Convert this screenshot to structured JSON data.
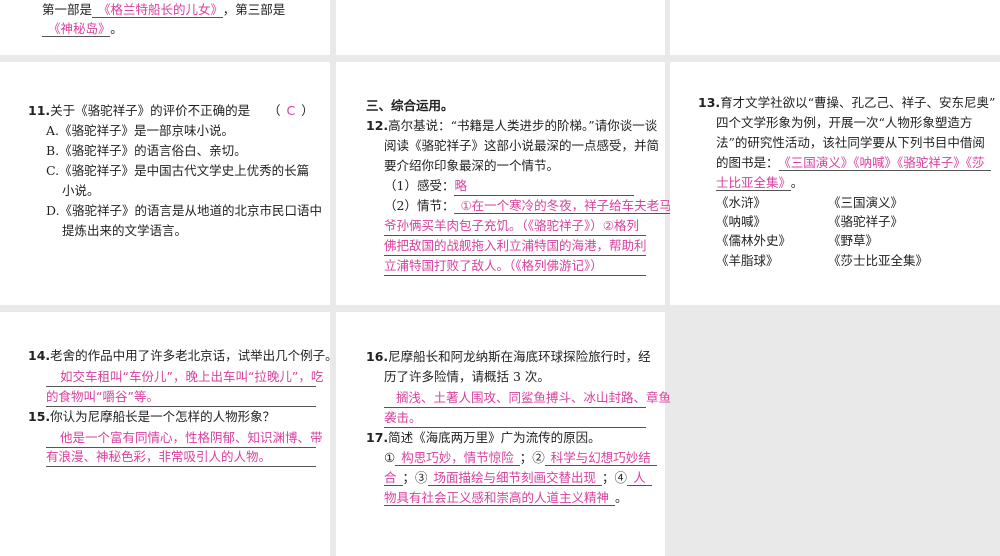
{
  "top_left": {
    "prefix": "第一部是",
    "answer1": "《格兰特船长的儿女》",
    "mid": "，第三部是",
    "answer2": "《神秘岛》",
    "end": "。"
  },
  "q11": {
    "num": "11.",
    "stem": "关于《骆驼祥子》的评价不正确的是",
    "paren_open": "（",
    "answer": "C",
    "paren_close": "）",
    "option_lines": [
      "A.《骆驼祥子》是一部京味小说。",
      "B.《骆驼祥子》的语言俗白、亲切。",
      "C.《骆驼祥子》是中国古代文学史上优秀的长篇",
      "小说。",
      "D.《骆驼祥子》的语言是从地道的北京市民口语中",
      "提炼出来的文学语言。"
    ]
  },
  "section3": "三、综合运用。",
  "q12": {
    "num": "12.",
    "stem_lines": [
      "高尔基说：“书籍是人类进步的阶梯。”请你谈一谈",
      "阅读《骆驼祥子》这部小说最深的一点感受，并简",
      "要介绍你印象最深的一个情节。"
    ],
    "part1_label": "（1）感受：",
    "part1_answer": "略",
    "part2_label": "（2）情节：",
    "part2_answer_lines": [
      "①在一个寒冷的冬夜，祥子给车夫老马",
      "爷孙俩买羊肉包子充饥。（《骆驼祥子》）②格列",
      "佛把敌国的战舰拖入利立浦特国的海港，帮助利",
      "立浦特国打败了敌人。（《格列佛游记》）"
    ]
  },
  "q13": {
    "num": "13.",
    "stem_lines": [
      "育才文学社欲以“曹操、孔乙己、祥子、安东尼奥”",
      "四个文学形象为例，开展一次“人物形象塑造方",
      "法”的研究性活动，该社同学要从下列书目中借阅"
    ],
    "answer_prefix": "的图书是：",
    "answer_lines": [
      "《三国演义》《呐喊》《骆驼祥子》《莎",
      "士比亚全集》"
    ],
    "end": "。",
    "books_left": [
      "《水浒》",
      "《呐喊》",
      "《儒林外史》",
      "《羊脂球》"
    ],
    "books_right": [
      "《三国演义》",
      "《骆驼祥子》",
      "《野草》",
      "《莎士比亚全集》"
    ]
  },
  "q14": {
    "num": "14.",
    "stem": "老舍的作品中用了许多老北京话，试举出几个例子。",
    "answer_lines": [
      "如交车租叫“车份儿”，晚上出车叫“拉晚儿”，吃",
      "的食物叫“嚼谷”等。"
    ]
  },
  "q15": {
    "num": "15.",
    "stem": "你认为尼摩船长是一个怎样的人物形象？",
    "answer_lines": [
      "他是一个富有同情心，性格阴郁、知识渊博、带",
      "有浪漫、神秘色彩，非常吸引人的人物。"
    ]
  },
  "q16": {
    "num": "16.",
    "stem_lines": [
      "尼摩船长和阿龙纳斯在海底环球探险旅行时，经",
      "历了许多险情，请概括 3 次。"
    ],
    "answer_lines": [
      "搁浅、土著人围攻、同鲨鱼搏斗、冰山封路、章鱼",
      "袭击。"
    ]
  },
  "q17": {
    "num": "17.",
    "stem": "简述《海底两万里》广为流传的原因。",
    "m1": "①",
    "a1": "构思巧妙，情节惊险",
    "m2": "；②",
    "a2a": "科学与幻想巧妙结",
    "a2b": "合",
    "m3": "；③",
    "a3": "场面描绘与细节刻画交替出现",
    "m4": "；④",
    "a4a": "人",
    "a4b": "物具有社会正义感和崇高的人道主义精神",
    "end": "。"
  }
}
